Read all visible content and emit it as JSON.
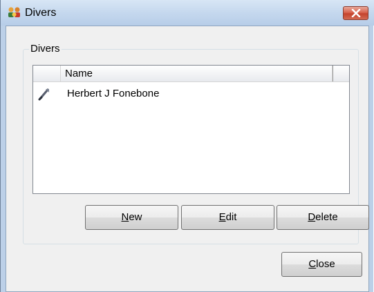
{
  "window": {
    "title": "Divers",
    "title_icon": "divers-app-icon",
    "close_icon": "close-icon"
  },
  "group": {
    "label": "Divers"
  },
  "list": {
    "columns": [
      "",
      "Name",
      ""
    ],
    "rows": [
      {
        "icon": "dive-flag-icon",
        "name": "Herbert J Fonebone"
      }
    ]
  },
  "buttons": {
    "new": {
      "mnemonic": "N",
      "rest": "ew"
    },
    "edit": {
      "mnemonic": "E",
      "rest": "dit"
    },
    "delete": {
      "mnemonic": "D",
      "rest": "elete"
    },
    "close": {
      "mnemonic": "C",
      "rest": "lose"
    }
  }
}
